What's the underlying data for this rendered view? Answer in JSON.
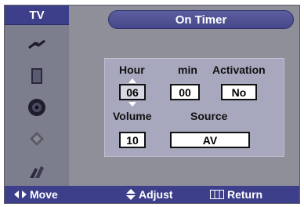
{
  "header": {
    "tv_label": "TV",
    "title": "On Timer"
  },
  "sidebar": {
    "icons": [
      "antenna-icon",
      "picture-icon",
      "speaker-icon",
      "channel-icon",
      "setup-icon"
    ]
  },
  "timer": {
    "hour_label": "Hour",
    "min_label": "min",
    "activation_label": "Activation",
    "hour_value": "06",
    "min_value": "00",
    "activation_value": "No",
    "volume_label": "Volume",
    "source_label": "Source",
    "volume_value": "10",
    "source_value": "AV"
  },
  "footer": {
    "move_label": "Move",
    "adjust_label": "Adjust",
    "return_label": "Return"
  },
  "colors": {
    "osd_bg": "#8f8f99",
    "bar_blue": "#3d3f8a",
    "panel_bg": "#a7a8bd"
  }
}
